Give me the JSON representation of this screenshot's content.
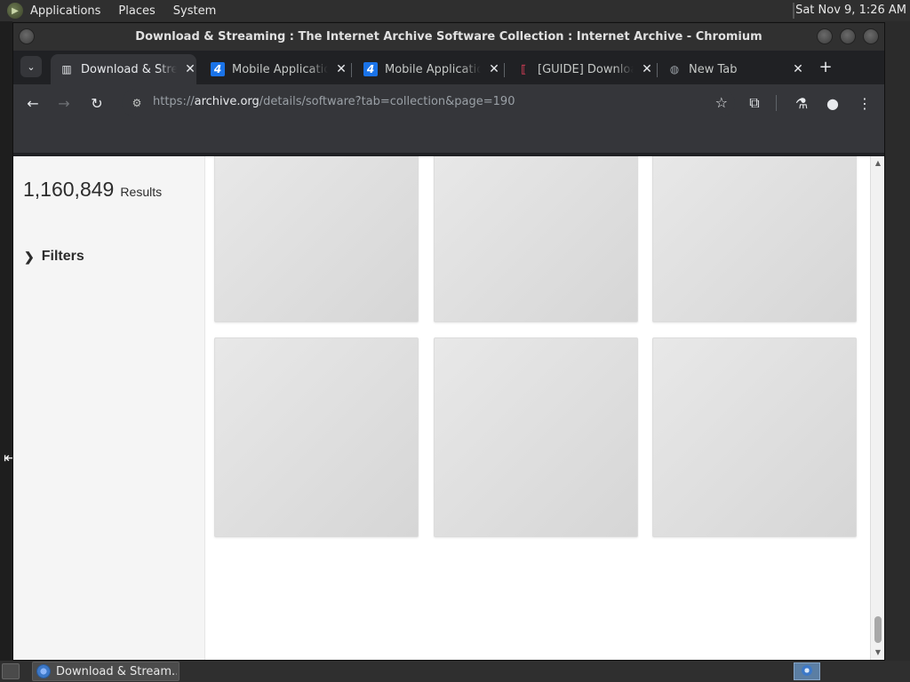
{
  "top_panel": {
    "menus": [
      "Applications",
      "Places",
      "System"
    ],
    "clock": "Sat Nov 9,  1:26 AM"
  },
  "window": {
    "title": "Download & Streaming : The Internet Archive Software Collection : Internet Archive - Chromium"
  },
  "tabs": [
    {
      "title": "Download & Streaming",
      "favicon": "archive-icon",
      "active": true
    },
    {
      "title": "Mobile Applications",
      "favicon": "four-icon",
      "active": false
    },
    {
      "title": "Mobile Applications",
      "favicon": "four-icon",
      "active": false
    },
    {
      "title": "[GUIDE] Download",
      "favicon": "guide-icon",
      "active": false
    },
    {
      "title": "New Tab",
      "favicon": "globe-icon",
      "active": false
    }
  ],
  "toolbar": {
    "url_host": "archive.org",
    "url_rest": "/details/software?tab=collection&page=190",
    "url_scheme": "https://"
  },
  "page": {
    "results_count": "1,160,849",
    "results_label": "Results",
    "filters_label": "Filters"
  },
  "taskbar": {
    "task_label": "Download & Stream..."
  },
  "colors": {
    "chrome_dark": "#35363a",
    "tab_strip": "#202124",
    "page_bg": "#ffffff",
    "sidebar_bg": "#f5f5f5",
    "tile_placeholder": "#dedede"
  }
}
